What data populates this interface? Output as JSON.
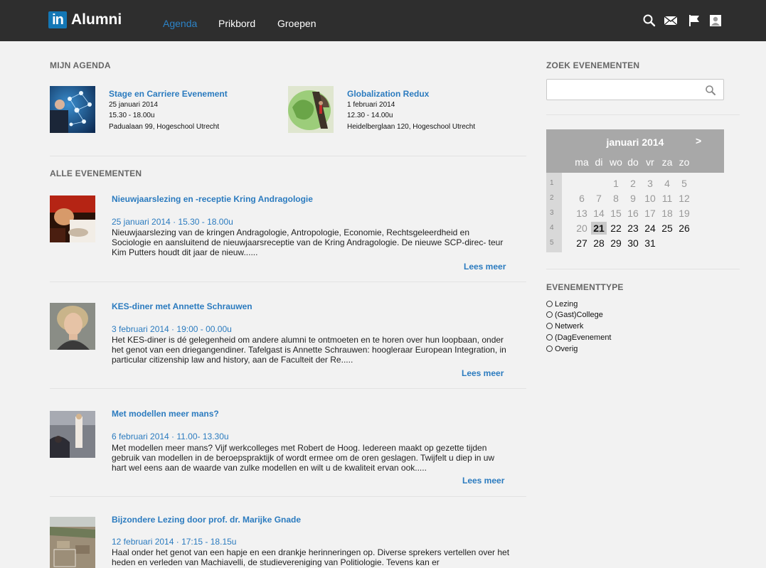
{
  "header": {
    "logo_mark": "in",
    "logo_text": "Alumni",
    "nav": [
      "Agenda",
      "Prikbord",
      "Groepen"
    ]
  },
  "agenda": {
    "heading": "MIJN AGENDA",
    "items": [
      {
        "title": "Stage en Carriere Evenement",
        "date": "25 januari 2014",
        "time": "15.30 - 18.00u",
        "location": "Padualaan 99, Hogeschool Utrecht"
      },
      {
        "title": "Globalization Redux",
        "date": "1 februari 2014",
        "time": "12.30 - 14.00u",
        "location": "Heidelberglaan 120, Hogeschool Utrecht"
      }
    ]
  },
  "events": {
    "heading": "ALLE EVENEMENTEN",
    "read_more": "Lees meer",
    "items": [
      {
        "title": "Nieuwjaarslezing en -receptie Kring Andragologie",
        "date": "25 januari 2014 · 15.30 - 18.00u",
        "desc": "Nieuwjaarslezing van de kringen Andragologie, Antropologie, Economie, Rechtsgeleerdheid en Sociologie en aansluitend de nieuwjaarsreceptie van de Kring Andragologie. De nieuwe SCP-direc- teur Kim Putters houdt dit jaar de nieuw......"
      },
      {
        "title": "KES-diner met Annette Schrauwen",
        "date": "3 februari 2014 · 19:00 - 00.00u",
        "desc": "Het KES-diner is dé gelegenheid om andere alumni te ontmoeten en te horen over hun loopbaan, onder het genot van een driegangendiner. Tafelgast is Annette Schrauwen: hoogleraar European Integration, in particular citizenship law and history, aan de Faculteit der Re....."
      },
      {
        "title": "Met modellen meer mans?",
        "date": "6 februari 2014 · 11.00- 13.30u",
        "desc": "Met modellen meer mans? Vijf werkcolleges met Robert de Hoog. Iedereen maakt op gezette tijden gebruik van modellen in de beroepspraktijk of wordt ermee om de oren geslagen. Twijfelt u diep in uw hart wel eens aan de waarde van zulke modellen en wilt u de kwaliteit ervan ook....."
      },
      {
        "title": "Bijzondere Lezing door prof. dr. Marijke Gnade",
        "date": "12 februari 2014 · 17:15 - 18.15u",
        "desc": "Haal onder het genot van een hapje en een drankje herinneringen op. Diverse sprekers vertellen over het heden en verleden van Machiavelli, de studievereniging van Politiologie. Tevens kan er"
      }
    ]
  },
  "search": {
    "heading": "ZOEK EVENEMENTEN",
    "placeholder": ""
  },
  "calendar": {
    "title": "januari 2014",
    "next": ">",
    "dow": [
      "ma",
      "di",
      "wo",
      "do",
      "vr",
      "za",
      "zo"
    ],
    "weeks": [
      "1",
      "2",
      "3",
      "4",
      "5"
    ],
    "days": [
      [
        "",
        "",
        "1",
        "2",
        "3",
        "4",
        "5"
      ],
      [
        "6",
        "7",
        "8",
        "9",
        "10",
        "11",
        "12"
      ],
      [
        "13",
        "14",
        "15",
        "16",
        "17",
        "18",
        "19"
      ],
      [
        "20",
        "21",
        "22",
        "23",
        "24",
        "25",
        "26"
      ],
      [
        "27",
        "28",
        "29",
        "30",
        "31",
        "",
        ""
      ]
    ],
    "today": "21"
  },
  "event_types": {
    "heading": "EVENEMENTTYPE",
    "options": [
      "Lezing",
      "(Gast)College",
      "Netwerk",
      "(DagEvenement",
      "Overig"
    ]
  }
}
